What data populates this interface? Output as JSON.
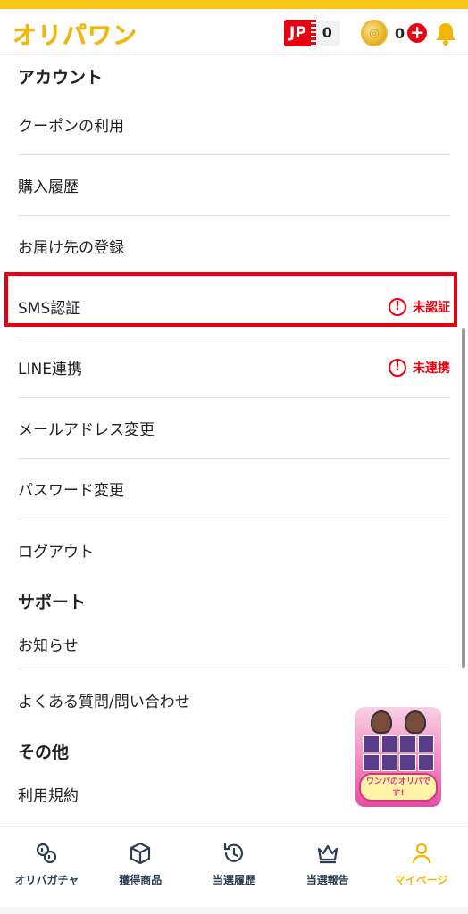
{
  "header": {
    "logo": "オリパワン",
    "jp_label": "JP",
    "jp_value": "0",
    "coin_value": "0",
    "plus": "+"
  },
  "sections": [
    {
      "title": "アカウント",
      "items": [
        "クーポンの利用",
        "購入履歴",
        "お届け先の登録",
        "SMS認証",
        "LINE連携",
        "メールアドレス変更",
        "パスワード変更",
        "ログアウト"
      ]
    },
    {
      "title": "サポート",
      "items": [
        "お知らせ",
        "よくある質問/問い合わせ"
      ]
    },
    {
      "title": "その他",
      "items": [
        "利用規約"
      ]
    }
  ],
  "status": {
    "sms": "未認証",
    "line": "未連携",
    "icon": "!"
  },
  "banner": {
    "label": "ワンパのオリパです!"
  },
  "nav": [
    {
      "label": "オリパガチャ",
      "icon": "gacha-icon"
    },
    {
      "label": "獲得商品",
      "icon": "box-icon"
    },
    {
      "label": "当選履歴",
      "icon": "history-icon"
    },
    {
      "label": "当選報告",
      "icon": "crown-icon"
    },
    {
      "label": "マイページ",
      "icon": "user-icon"
    }
  ],
  "colors": {
    "brand": "#f2b705",
    "alert": "#e60012",
    "nav_text": "#2c3e50"
  }
}
